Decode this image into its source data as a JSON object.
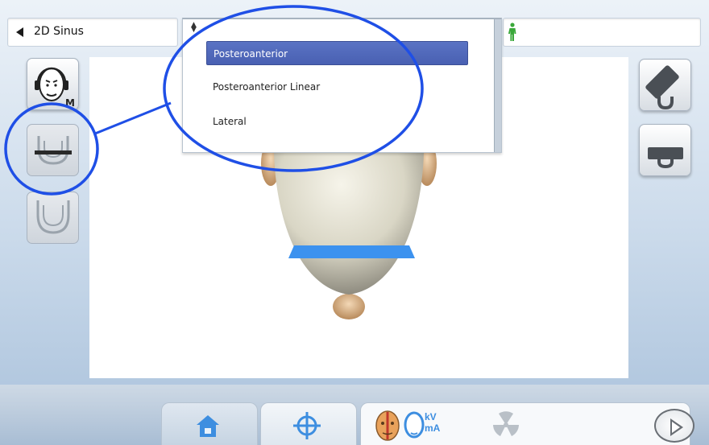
{
  "topbar": {
    "program_label": "2D Sinus",
    "back_icon": "back-triangle-icon",
    "patient_icon": "person-icon",
    "patient_color": "#3aa83a"
  },
  "dropdown": {
    "sort_icon": "sort-arrows-icon",
    "options": [
      {
        "label": "Posteroanterior",
        "selected": true
      },
      {
        "label": "Posteroanterior Linear",
        "selected": false
      },
      {
        "label": "Lateral",
        "selected": false
      }
    ],
    "highlight_color": "#5068bc"
  },
  "left_buttons": [
    {
      "icon": "patient-head-headphones-icon",
      "label": "M"
    },
    {
      "icon": "bite-block-tray-icon",
      "label": ""
    },
    {
      "icon": "jaw-arch-icon",
      "label": ""
    }
  ],
  "right_buttons": [
    {
      "icon": "headrest-temple-icon"
    },
    {
      "icon": "chin-rest-icon"
    }
  ],
  "bottom_bar": {
    "icons": [
      "home-icon",
      "target-crosshair-icon",
      "patient-face-icon",
      "kv-ma-icon",
      "radiation-icon"
    ],
    "kv_text": "kV",
    "ma_text": "mA",
    "start_icon": "play-icon"
  },
  "colors": {
    "annotation_circle": "#1f4fe6",
    "alignment_bar": "#3c92ef",
    "button_blue": "#3d8ee0"
  }
}
